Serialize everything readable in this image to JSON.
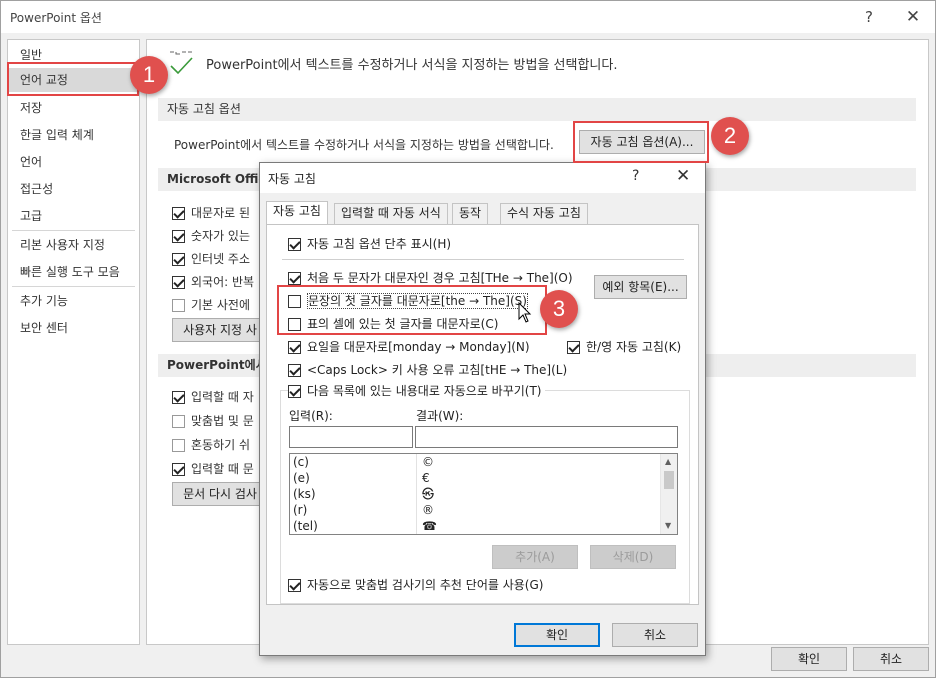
{
  "window": {
    "title": "PowerPoint 옵션",
    "help": "?",
    "close": "✕"
  },
  "sidebar": {
    "items": [
      "일반",
      "언어 교정",
      "저장",
      "한글 입력 체계",
      "언어",
      "접근성",
      "고급",
      "리본 사용자 지정",
      "빠른 실행 도구 모음",
      "추가 기능",
      "보안 센터"
    ]
  },
  "main": {
    "header_text": "PowerPoint에서 텍스트를 수정하거나 서식을 지정하는 방법을 선택합니다.",
    "autocorrect_section": "자동 고침 옵션",
    "autocorrect_desc": "PowerPoint에서 텍스트를 수정하거나 서식을 지정하는 방법을 선택합니다.",
    "autocorrect_button": "자동 고침 옵션(A)...",
    "office_section": "Microsoft Office",
    "office_options": [
      "대문자로 된",
      "숫자가 있는",
      "인터넷 주소",
      "외국어: 반복",
      "기본 사전에"
    ],
    "custom_dict_button": "사용자 지정 사",
    "ppt_section": "PowerPoint에서",
    "ppt_options": [
      "입력할 때 자",
      "맞춤법 및 문",
      "혼동하기 쉬",
      "입력할 때 문"
    ],
    "recheck_button": "문서 다시 검사"
  },
  "footer": {
    "ok": "확인",
    "cancel": "취소"
  },
  "dialog": {
    "title": "자동 고침",
    "help": "?",
    "close": "✕",
    "tabs": [
      "자동 고침",
      "입력할 때 자동 서식",
      "동작",
      "수식 자동 고침"
    ],
    "show_buttons": "자동 고침 옵션 단추 표시(H)",
    "two_initial": "처음 두 문자가 대문자인 경우 고침[THe → The](O)",
    "exceptions_button": "예외 항목(E)...",
    "capitalize_sentence": "문장의 첫 글자를 대문자로[the → The](S)",
    "capitalize_table": "표의 셀에 있는 첫 글자를 대문자로(C)",
    "capitalize_days": "요일을 대문자로[monday → Monday](N)",
    "han_eng": "한/영 자동 고침(K)",
    "caps_lock": "<Caps Lock> 키 사용 오류 고침[tHE → The](L)",
    "replace_text": "다음 목록에 있는 내용대로 자동으로 바꾸기(T)",
    "input_label": "입력(R):",
    "result_label": "결과(W):",
    "list": [
      {
        "input": "(c)",
        "result": "©"
      },
      {
        "input": "(e)",
        "result": "€"
      },
      {
        "input": "(ks)",
        "result": "㉿"
      },
      {
        "input": "(r)",
        "result": "®"
      },
      {
        "input": "(tel)",
        "result": "☎"
      }
    ],
    "add_button": "추가(A)",
    "delete_button": "삭제(D)",
    "suggestions": "자동으로 맞춤법 검사기의 추천 단어를 사용(G)",
    "ok": "확인",
    "cancel": "취소"
  },
  "callouts": [
    "1",
    "2",
    "3"
  ],
  "colors": {
    "callout": "#e0504e",
    "selected": "#d9d9d9",
    "primary_border": "#0078d7"
  }
}
